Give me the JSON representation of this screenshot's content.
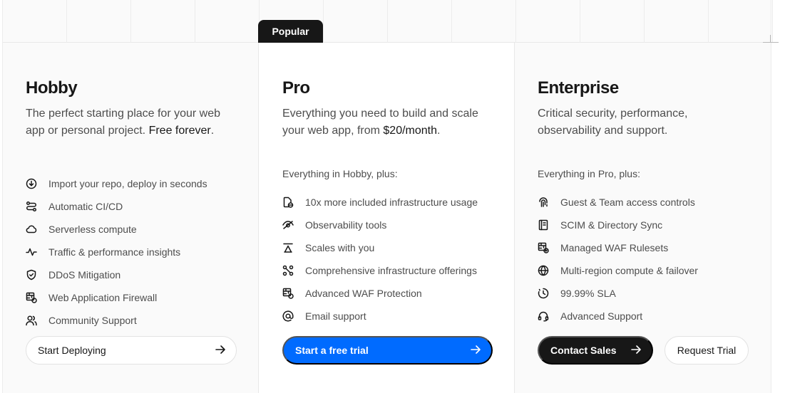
{
  "popular_badge": "Popular",
  "plans": {
    "hobby": {
      "title": "Hobby",
      "description": "The perfect starting place for your web app or personal project.",
      "description_highlight": "Free forever",
      "description_suffix": ".",
      "features": [
        {
          "icon": "arrow-down-circle-icon",
          "label": "Import your repo, deploy in seconds"
        },
        {
          "icon": "git-branch-icon",
          "label": "Automatic CI/CD"
        },
        {
          "icon": "cloud-icon",
          "label": "Serverless compute"
        },
        {
          "icon": "activity-icon",
          "label": "Traffic & performance insights"
        },
        {
          "icon": "shield-icon",
          "label": "DDoS Mitigation"
        },
        {
          "icon": "firewall-icon",
          "label": "Web Application Firewall"
        },
        {
          "icon": "users-icon",
          "label": "Community Support"
        }
      ],
      "cta_label": "Start Deploying"
    },
    "pro": {
      "title": "Pro",
      "description": "Everything you need to build and scale your web app, from",
      "description_highlight": "$20/month",
      "description_suffix": ".",
      "plus_label": "Everything in Hobby, plus:",
      "features": [
        {
          "icon": "page-globe-icon",
          "label": "10x more included infrastructure usage"
        },
        {
          "icon": "eye-icon",
          "label": "Observability tools"
        },
        {
          "icon": "scale-icon",
          "label": "Scales with you"
        },
        {
          "icon": "nodes-icon",
          "label": "Comprehensive infrastructure offerings"
        },
        {
          "icon": "firewall-icon",
          "label": "Advanced WAF Protection"
        },
        {
          "icon": "at-sign-icon",
          "label": "Email support"
        }
      ],
      "cta_label": "Start a free trial"
    },
    "enterprise": {
      "title": "Enterprise",
      "description": "Critical security, performance, observability and support.",
      "plus_label": "Everything in Pro, plus:",
      "features": [
        {
          "icon": "fingerprint-icon",
          "label": "Guest & Team access controls"
        },
        {
          "icon": "directory-icon",
          "label": "SCIM & Directory Sync"
        },
        {
          "icon": "firewall-check-icon",
          "label": "Managed WAF Rulesets"
        },
        {
          "icon": "globe-icon",
          "label": "Multi-region compute & failover"
        },
        {
          "icon": "clock-icon",
          "label": "99.99% SLA"
        },
        {
          "icon": "headset-icon",
          "label": "Advanced Support"
        }
      ],
      "cta_primary_label": "Contact Sales",
      "cta_secondary_label": "Request Trial"
    }
  },
  "colors": {
    "accent_blue": "#006bff",
    "dark": "#171717",
    "muted_text": "#4d4d4d",
    "panel_gray": "#fafafa"
  }
}
